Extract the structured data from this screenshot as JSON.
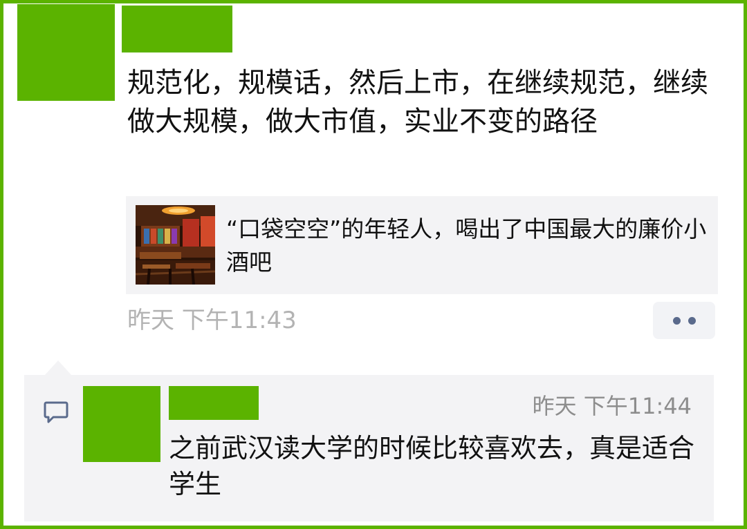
{
  "post": {
    "text": "规范化，规模话，然后上市，在继续规范，继续做大规模，做大市值，实业不变的路径",
    "link": {
      "title": "“口袋空空”的年轻人，喝出了中国最大的廉价小酒吧"
    },
    "time": "昨天 下午11:43"
  },
  "comment": {
    "time": "昨天 下午11:44",
    "text": "之前武汉读大学的时候比较喜欢去，真是适合学生"
  },
  "icons": {
    "more": "more-dots-icon",
    "comment": "comment-bubble-icon"
  },
  "colors": {
    "brand_block": "#5bb300",
    "card_bg": "#f3f3f5",
    "muted_text": "#b3b3b3",
    "dot_color": "#5a6a8c"
  }
}
